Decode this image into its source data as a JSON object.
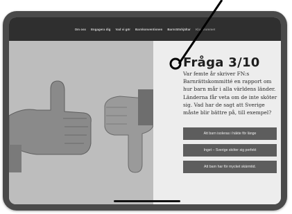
{
  "nav": {
    "items": [
      "Om oss",
      "Engagera dig",
      "Vad vi gör",
      "Barnkonventionen",
      "Barnrättshjältar",
      "Klassrummet"
    ]
  },
  "question": {
    "title": "Fråga 3/10",
    "body": "Var femte år skriver FN:s Barnrättskommitté en rapport om hur barn mår i alla världens länder. Länderna får veta om de inte sköter sig. Vad har de sagt att Sverige måste blir bättre på, till exempel?"
  },
  "answers": [
    "Att barn isoleras i häkte för länge",
    "Inget – Sverige sköter sig perfekt",
    "Att barn har för mycket skärmtid."
  ],
  "hero": {
    "image": "thumbs-up-thumbs-down-hands"
  },
  "colors": {
    "nav_bg": "#2f2f2f",
    "panel_bg": "#ededed",
    "button_bg": "#5d5d5d",
    "device_frame": "#4a4a4a"
  }
}
